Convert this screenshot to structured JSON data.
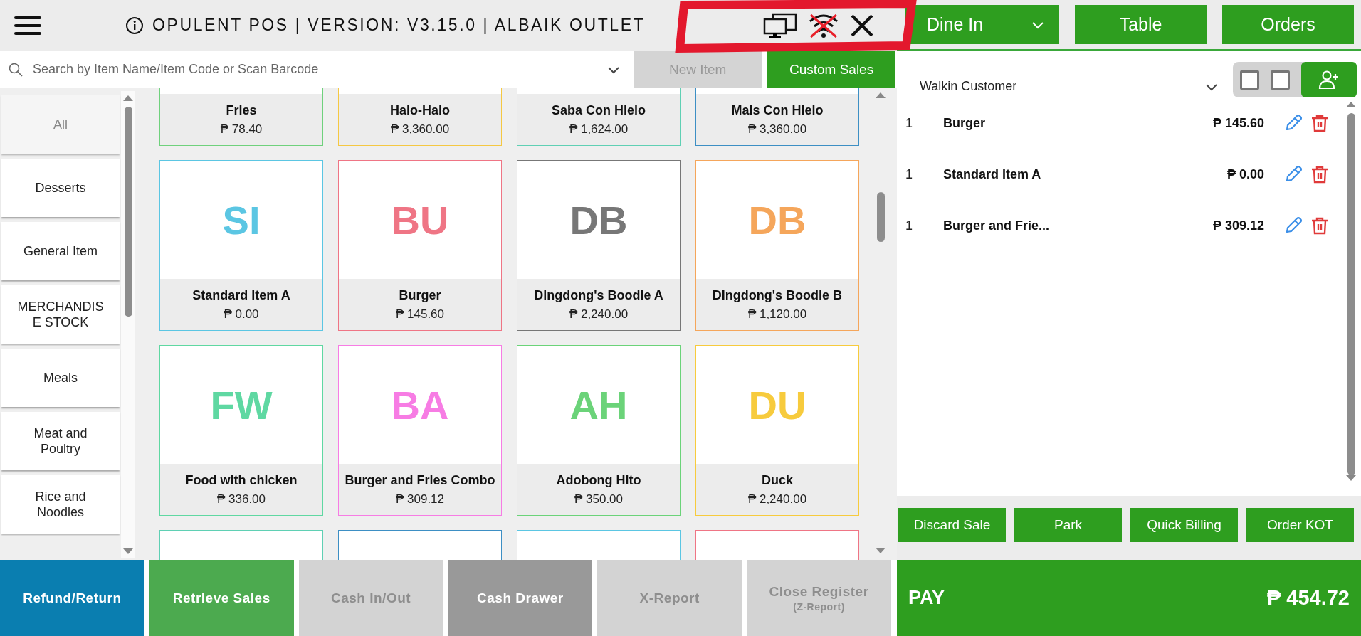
{
  "header": {
    "title": "OPULENT POS | VERSION: V3.15.0 | ALBAIK OUTLET"
  },
  "order_type": {
    "label": "Dine In"
  },
  "header_buttons": [
    "Table",
    "Orders"
  ],
  "search": {
    "placeholder": "Search by Item Name/Item Code or Scan Barcode"
  },
  "search_buttons": [
    {
      "label": "New Item",
      "disabled": true
    },
    {
      "label": "Custom Sales",
      "disabled": false
    }
  ],
  "categories": [
    {
      "label": "All",
      "selected": true
    },
    {
      "label": "Desserts",
      "selected": false
    },
    {
      "label": "General Item",
      "selected": false
    },
    {
      "label": "MERCHANDISE STOCK",
      "selected": false
    },
    {
      "label": "Meals",
      "selected": false
    },
    {
      "label": "Meat and Poultry",
      "selected": false
    },
    {
      "label": "Rice and Noodles",
      "selected": false
    }
  ],
  "products": [
    {
      "kind": "footer_only",
      "name": "Fries",
      "price": "₱ 78.40",
      "color": "#6fd17c"
    },
    {
      "kind": "footer_only",
      "name": "Halo-Halo",
      "price": "₱ 3,360.00",
      "color": "#f5c842"
    },
    {
      "kind": "footer_only",
      "name": "Saba Con Hielo",
      "price": "₱ 1,624.00",
      "color": "#5fd0b4"
    },
    {
      "kind": "footer_only",
      "name": "Mais Con Hielo",
      "price": "₱ 3,360.00",
      "color": "#3d8fc4"
    },
    {
      "kind": "full",
      "initials": "SI",
      "name": "Standard Item A",
      "price": "₱ 0.00",
      "color": "#5bc6e3"
    },
    {
      "kind": "full",
      "initials": "BU",
      "name": "Burger",
      "price": "₱ 145.60",
      "color": "#ef7585"
    },
    {
      "kind": "full",
      "initials": "DB",
      "name": "Dingdong's Boodle A",
      "price": "₱ 2,240.00",
      "color": "#777777"
    },
    {
      "kind": "full",
      "initials": "DB",
      "name": "Dingdong's Boodle B",
      "price": "₱ 1,120.00",
      "color": "#f5a65b"
    },
    {
      "kind": "full",
      "initials": "FW",
      "name": "Food with chicken",
      "price": "₱ 336.00",
      "color": "#5fd8a2"
    },
    {
      "kind": "full",
      "initials": "BA",
      "name": "Burger and Fries Combo",
      "price": "₱ 309.12",
      "color": "#f77ce4"
    },
    {
      "kind": "full",
      "initials": "AH",
      "name": "Adobong Hito",
      "price": "₱ 350.00",
      "color": "#6bd379"
    },
    {
      "kind": "full",
      "initials": "DU",
      "name": "Duck",
      "price": "₱ 2,240.00",
      "color": "#f7cb3d"
    },
    {
      "kind": "top_only",
      "color": "#5fd0b4"
    },
    {
      "kind": "top_only",
      "color": "#3d8fc4"
    },
    {
      "kind": "top_only",
      "color": "#5bc6e3"
    },
    {
      "kind": "top_only",
      "color": "#ef7585"
    }
  ],
  "customer": {
    "value": "Walkin Customer"
  },
  "customer_checkboxes": [
    {
      "checked": false
    },
    {
      "checked": false
    }
  ],
  "cart": [
    {
      "qty": "1",
      "name": "Burger",
      "price": "₱ 145.60"
    },
    {
      "qty": "1",
      "name": "Standard Item A",
      "price": "₱ 0.00"
    },
    {
      "qty": "1",
      "name": "Burger and Frie...",
      "price": "₱ 309.12"
    }
  ],
  "cart_actions": [
    "Discard Sale",
    "Park",
    "Quick Billing",
    "Order KOT"
  ],
  "footer_buttons": [
    {
      "kind": "primary",
      "label": "Refund/Return",
      "disabled": false
    },
    {
      "kind": "success",
      "label": "Retrieve Sales",
      "disabled": false
    },
    {
      "kind": "plain",
      "label": "Cash In/Out",
      "disabled": true
    },
    {
      "kind": "dark",
      "label": "Cash Drawer",
      "disabled": false
    },
    {
      "kind": "plain",
      "label": "X-Report",
      "disabled": true
    },
    {
      "kind": "plain",
      "label": "Close Register",
      "sublabel": "(Z-Report)",
      "disabled": true
    }
  ],
  "pay": {
    "label": "PAY",
    "total": "₱ 454.72"
  }
}
